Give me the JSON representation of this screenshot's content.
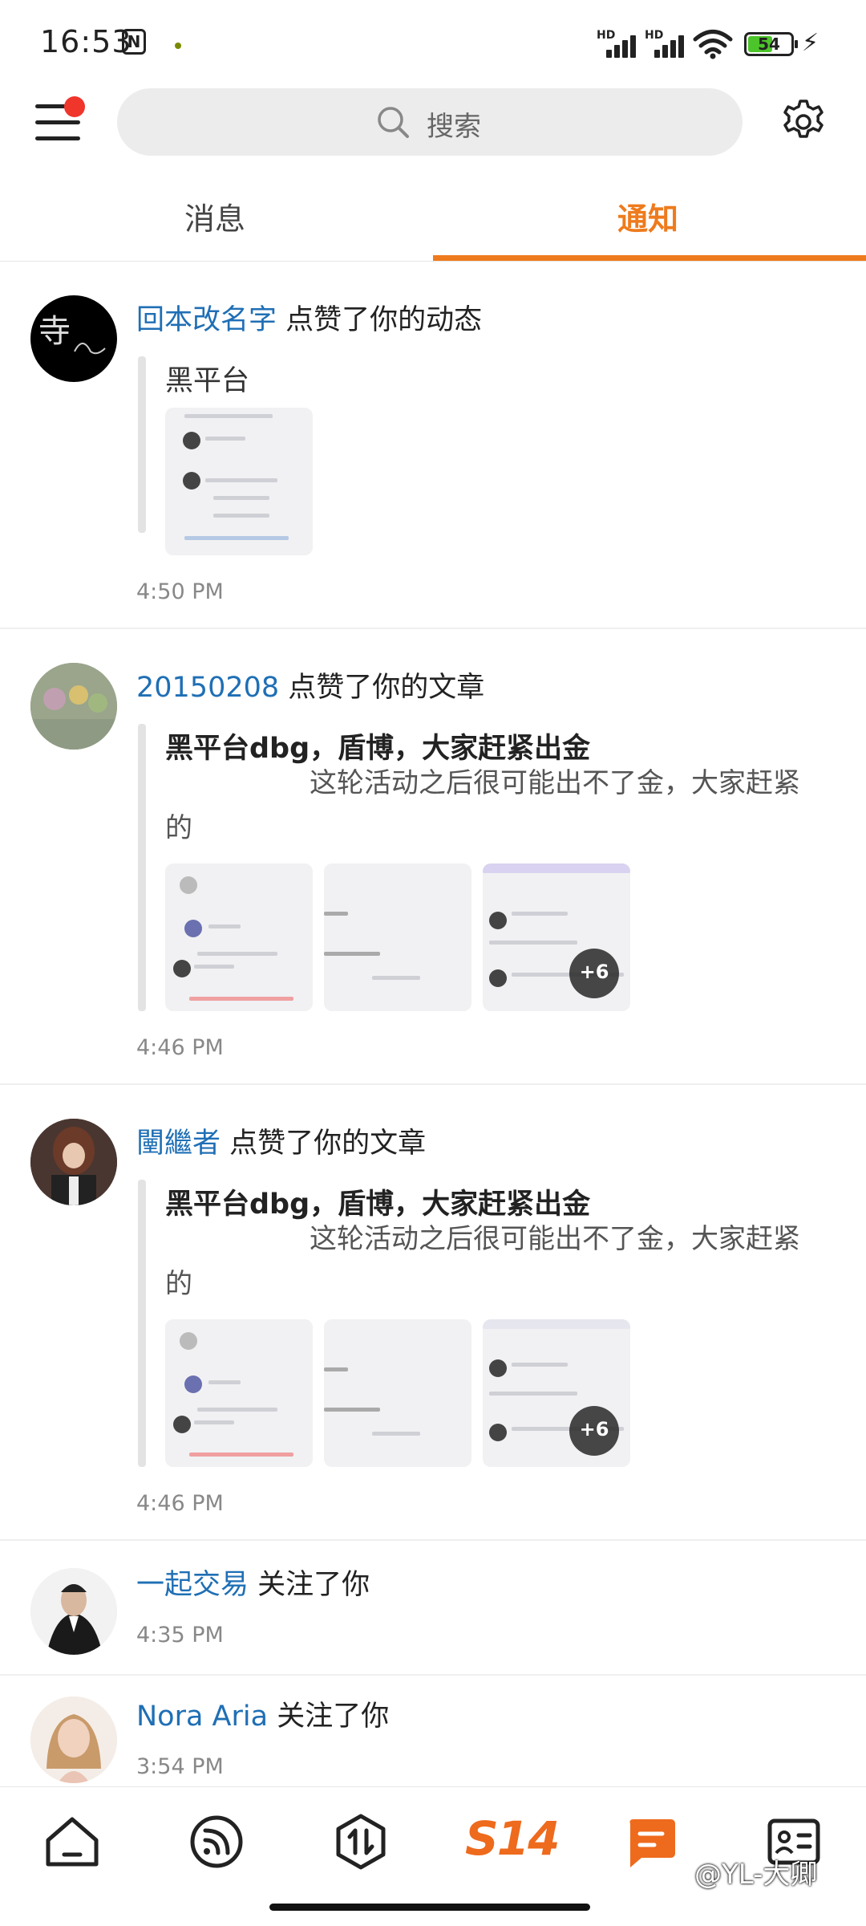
{
  "status_bar": {
    "time": "16:53",
    "battery": "54",
    "signal_label": "HD"
  },
  "header": {
    "search_placeholder": "搜索"
  },
  "tabs": [
    {
      "label": "消息",
      "active": false
    },
    {
      "label": "通知",
      "active": true
    }
  ],
  "colors": {
    "accent": "#ee7b1d",
    "username": "#1f6fb5",
    "badge": "#f0352b"
  },
  "notifications": [
    {
      "user": "回本改名字",
      "action": "点赞了你的动态",
      "post_title": "黑平台",
      "post_desc": "",
      "images": 1,
      "more": "",
      "time": "4:50 PM"
    },
    {
      "user": "20150208",
      "action": "点赞了你的文章",
      "post_title": "黑平台dbg，盾博，大家赶紧出金",
      "post_desc": "这轮活动之后很可能出不了金，大家赶紧的",
      "images": 3,
      "more": "+6",
      "time": "4:46 PM"
    },
    {
      "user": "闉繼者",
      "action": "点赞了你的文章",
      "post_title": "黑平台dbg，盾博，大家赶紧出金",
      "post_desc": "这轮活动之后很可能出不了金，大家赶紧的",
      "images": 3,
      "more": "+6",
      "time": "4:46 PM"
    },
    {
      "user": "一起交易",
      "action": "关注了你",
      "time": "4:35 PM"
    },
    {
      "user": "Nora Aria",
      "action": "关注了你",
      "time": "3:54 PM"
    }
  ],
  "bottom_nav": [
    {
      "icon": "home-icon"
    },
    {
      "icon": "feed-icon"
    },
    {
      "icon": "trade-icon"
    },
    {
      "icon": "s14-logo",
      "label": "S14"
    },
    {
      "icon": "message-icon",
      "active": true
    },
    {
      "icon": "contact-card-icon"
    }
  ],
  "watermark": "@YL-大卿"
}
